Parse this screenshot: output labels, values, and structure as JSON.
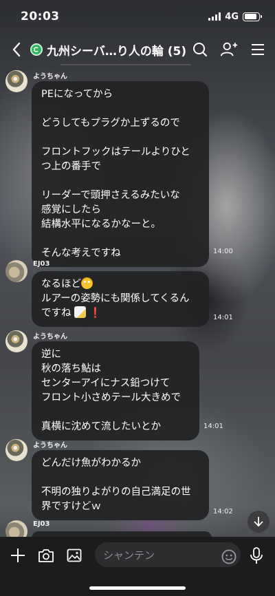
{
  "status_bar": {
    "time": "20:03",
    "network": "4G"
  },
  "header": {
    "title": "九州シーバ…り人の輪 (5)"
  },
  "messages": [
    {
      "sender": "ようちゃん",
      "lines": [
        "PEになってから",
        "",
        "どうしてもプラグか上ずるので",
        "",
        "フロントフックはテールよりひと",
        "つ上の番手で",
        "",
        "リーダーで頭押さえるみたいな",
        "感覚にしたら",
        "結構水平になるかなーと。",
        "",
        "そんな考えですね"
      ],
      "time": "14:00"
    },
    {
      "sender": "EJ03",
      "lines": [
        "なるほど",
        "ルアーの姿勢にも関係してくるん",
        "ですね"
      ],
      "time": "14:01",
      "emoji_after_line1": "flushed-face-emoji",
      "emoji_after_line3": [
        "memo-emoji",
        "exclamation-mark"
      ],
      "exclamation": "❗"
    },
    {
      "sender": "ようちゃん",
      "lines": [
        "逆に",
        "秋の落ち鮎は",
        "センターアイにナス鉛つけて",
        "フロント小さめテール大きめで",
        "",
        "真横に沈めて流したいとか"
      ],
      "time": "14:01"
    },
    {
      "sender": "ようちゃん",
      "lines": [
        "どんだけ魚がわかるか",
        "",
        "不明の独りよがりの自己満足の世",
        "界ですけどｗ"
      ],
      "time": "14:02"
    },
    {
      "sender": "EJ03"
    }
  ],
  "input": {
    "placeholder": "シャンテン"
  },
  "icons": [
    "back-icon",
    "group-icon",
    "search-icon",
    "add-friend-icon",
    "menu-icon",
    "plus-icon",
    "camera-icon",
    "image-icon",
    "emoji-icon",
    "mic-icon",
    "scroll-down-icon"
  ]
}
